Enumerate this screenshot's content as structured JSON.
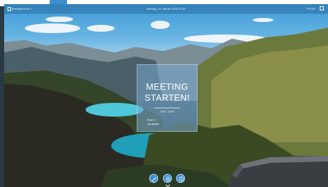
{
  "topbar": {
    "room_name": "Meeting Room 1",
    "datetime": "Montag, 14. Januar 2019 13:03",
    "language": "FR EN",
    "room_icon": "door-icon",
    "menu_icon": "grid-icon"
  },
  "card": {
    "title_line1": "MEETING",
    "title_line2": "STARTEN!",
    "subline": "13:00 - 14:00",
    "info_line1": "Room 1",
    "info_line2": "Jan Muster"
  },
  "actions": [
    {
      "icon": "pencil-icon"
    },
    {
      "icon": "settings-icon"
    },
    {
      "icon": "info-icon"
    }
  ],
  "colors": {
    "accent": "#3c8fd2",
    "topbar": "#2f7fb8"
  }
}
